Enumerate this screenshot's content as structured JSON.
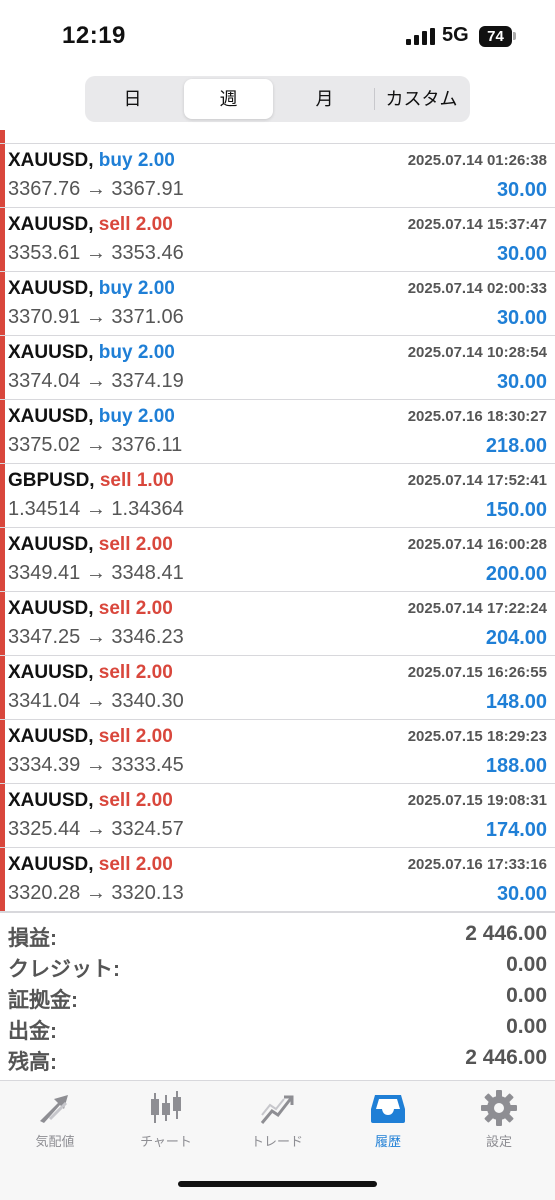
{
  "status_bar": {
    "time": "12:19",
    "network": "5G",
    "battery": "74"
  },
  "period_tabs": [
    {
      "label": "日",
      "active": false
    },
    {
      "label": "週",
      "active": true
    },
    {
      "label": "月",
      "active": false
    },
    {
      "label": "カスタム",
      "active": false
    }
  ],
  "trades": [
    {
      "symbol": "XAUUSD,",
      "side": "buy",
      "volume": "2.00",
      "open": "3367.76",
      "close": "3367.91",
      "date": "2025.07.14 01:26:38",
      "profit": "30.00"
    },
    {
      "symbol": "XAUUSD,",
      "side": "sell",
      "volume": "2.00",
      "open": "3353.61",
      "close": "3353.46",
      "date": "2025.07.14 15:37:47",
      "profit": "30.00"
    },
    {
      "symbol": "XAUUSD,",
      "side": "buy",
      "volume": "2.00",
      "open": "3370.91",
      "close": "3371.06",
      "date": "2025.07.14 02:00:33",
      "profit": "30.00"
    },
    {
      "symbol": "XAUUSD,",
      "side": "buy",
      "volume": "2.00",
      "open": "3374.04",
      "close": "3374.19",
      "date": "2025.07.14 10:28:54",
      "profit": "30.00"
    },
    {
      "symbol": "XAUUSD,",
      "side": "buy",
      "volume": "2.00",
      "open": "3375.02",
      "close": "3376.11",
      "date": "2025.07.16 18:30:27",
      "profit": "218.00"
    },
    {
      "symbol": "GBPUSD,",
      "side": "sell",
      "volume": "1.00",
      "open": "1.34514",
      "close": "1.34364",
      "date": "2025.07.14 17:52:41",
      "profit": "150.00"
    },
    {
      "symbol": "XAUUSD,",
      "side": "sell",
      "volume": "2.00",
      "open": "3349.41",
      "close": "3348.41",
      "date": "2025.07.14 16:00:28",
      "profit": "200.00"
    },
    {
      "symbol": "XAUUSD,",
      "side": "sell",
      "volume": "2.00",
      "open": "3347.25",
      "close": "3346.23",
      "date": "2025.07.14 17:22:24",
      "profit": "204.00"
    },
    {
      "symbol": "XAUUSD,",
      "side": "sell",
      "volume": "2.00",
      "open": "3341.04",
      "close": "3340.30",
      "date": "2025.07.15 16:26:55",
      "profit": "148.00"
    },
    {
      "symbol": "XAUUSD,",
      "side": "sell",
      "volume": "2.00",
      "open": "3334.39",
      "close": "3333.45",
      "date": "2025.07.15 18:29:23",
      "profit": "188.00"
    },
    {
      "symbol": "XAUUSD,",
      "side": "sell",
      "volume": "2.00",
      "open": "3325.44",
      "close": "3324.57",
      "date": "2025.07.15 19:08:31",
      "profit": "174.00"
    },
    {
      "symbol": "XAUUSD,",
      "side": "sell",
      "volume": "2.00",
      "open": "3320.28",
      "close": "3320.13",
      "date": "2025.07.16 17:33:16",
      "profit": "30.00"
    }
  ],
  "arrow": "→",
  "summary": [
    {
      "label": "損益:",
      "value": "2 446.00"
    },
    {
      "label": "クレジット:",
      "value": "0.00"
    },
    {
      "label": "証拠金:",
      "value": "0.00"
    },
    {
      "label": "出金:",
      "value": "0.00"
    },
    {
      "label": "残高:",
      "value": "2 446.00"
    }
  ],
  "tabbar": [
    {
      "label": "気配値",
      "icon": "quotes-arrows-icon",
      "active": false
    },
    {
      "label": "チャート",
      "icon": "candlestick-chart-icon",
      "active": false
    },
    {
      "label": "トレード",
      "icon": "trade-trend-icon",
      "active": false
    },
    {
      "label": "履歴",
      "icon": "history-inbox-icon",
      "active": true
    },
    {
      "label": "設定",
      "icon": "gear-icon",
      "active": false
    }
  ],
  "colors": {
    "buy": "#1f7fd6",
    "sell": "#d9473c",
    "profit": "#1f7fd6",
    "accent": "#1f7fd6"
  }
}
